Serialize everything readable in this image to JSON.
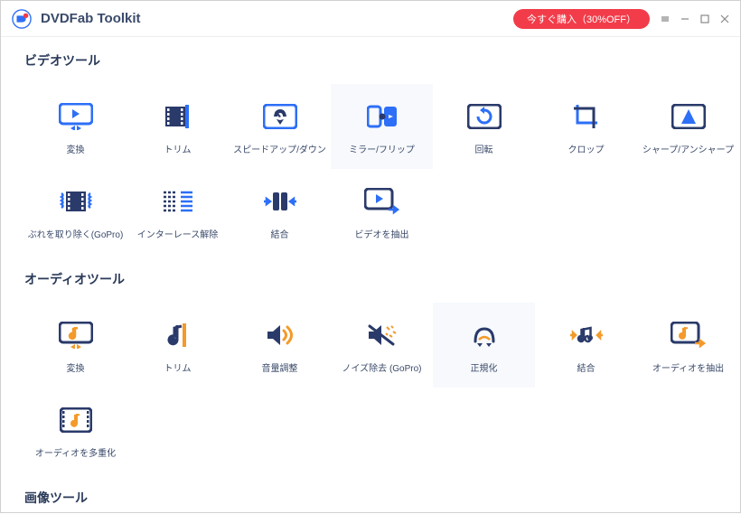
{
  "header": {
    "title": "DVDFab Toolkit",
    "buy": "今すぐ購入（30%OFF）"
  },
  "sections": {
    "video": {
      "title": "ビデオツール",
      "items": [
        {
          "name": "convert",
          "label": "変換"
        },
        {
          "name": "trim",
          "label": "トリム"
        },
        {
          "name": "speed",
          "label": "スピードアップ/ダウン"
        },
        {
          "name": "mirror",
          "label": "ミラー/フリップ",
          "hov": true
        },
        {
          "name": "rotate",
          "label": "回転"
        },
        {
          "name": "crop",
          "label": "クロップ"
        },
        {
          "name": "sharpen",
          "label": "シャープ/アンシャープ"
        },
        {
          "name": "deshake",
          "label": "ぶれを取り除く(GoPro)"
        },
        {
          "name": "deinterlace",
          "label": "インターレース解除"
        },
        {
          "name": "merge",
          "label": "結合"
        },
        {
          "name": "extract-video",
          "label": "ビデオを抽出"
        }
      ]
    },
    "audio": {
      "title": "オーディオツール",
      "items": [
        {
          "name": "a-convert",
          "label": "変換"
        },
        {
          "name": "a-trim",
          "label": "トリム"
        },
        {
          "name": "volume",
          "label": "音量調整"
        },
        {
          "name": "denoise",
          "label": "ノイズ除去 (GoPro)"
        },
        {
          "name": "normalize",
          "label": "正規化",
          "hov": true
        },
        {
          "name": "a-merge",
          "label": "結合"
        },
        {
          "name": "extract-audio",
          "label": "オーディオを抽出"
        },
        {
          "name": "multiplex",
          "label": "オーディオを多重化"
        }
      ]
    },
    "image": {
      "title": "画像ツール"
    }
  },
  "colors": {
    "blue": "#2d6ff7",
    "navy": "#2a3a6a",
    "orange": "#f39a2a"
  }
}
